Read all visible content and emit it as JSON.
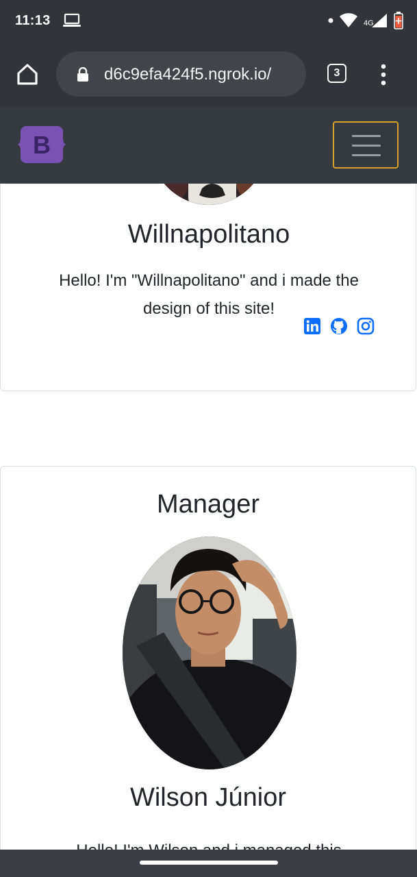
{
  "status_bar": {
    "time": "11:13",
    "network": "4G",
    "icons": [
      "laptop-icon",
      "dot-icon",
      "wifi-icon",
      "signal-icon",
      "battery-icon"
    ]
  },
  "browser": {
    "url": "d6c9efa424f5.ngrok.io/",
    "tab_count": "3",
    "icons": [
      "home-icon",
      "lock-icon",
      "tabs-icon",
      "more-vert-icon"
    ]
  },
  "navbar": {
    "brand_letter": "B",
    "brand_color": "#7952b3",
    "toggler_border_color": "#d4a22b"
  },
  "cards": [
    {
      "name": "Willnapolitano",
      "bio": "Hello! I'm \"Willnapolitano\" and i made the design of this site!",
      "social_icons": [
        "linkedin-icon",
        "github-icon",
        "instagram-icon"
      ],
      "social_color": "#0d6efd"
    },
    {
      "role": "Manager",
      "name": "Wilson Júnior",
      "bio": "Hello! I'm Wilson and i managed this"
    }
  ]
}
